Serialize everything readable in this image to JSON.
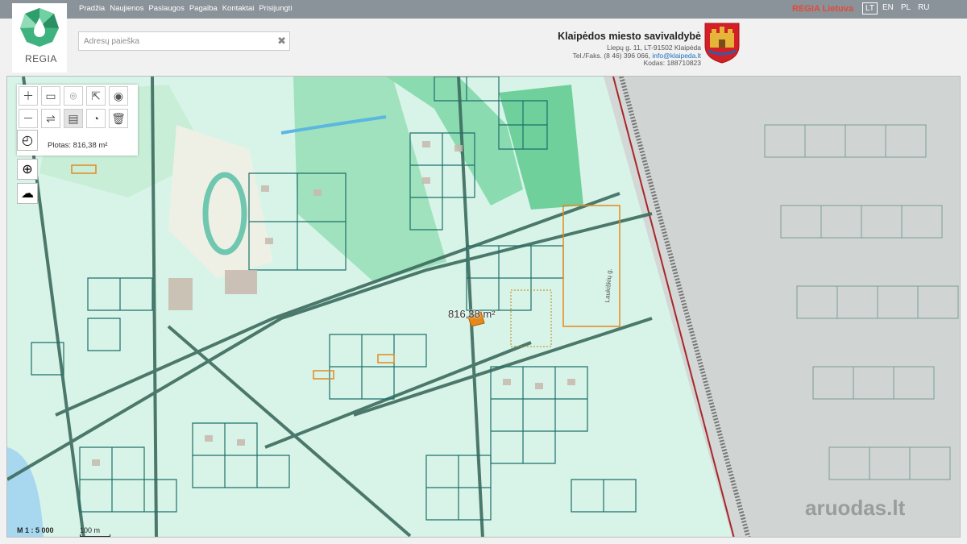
{
  "nav": {
    "items": [
      "Pradžia",
      "Naujienos",
      "Paslaugos",
      "Pagalba",
      "Kontaktai",
      "Prisijungti"
    ]
  },
  "brand": {
    "label": "REGIA Lietuva"
  },
  "languages": [
    "LT",
    "EN",
    "PL",
    "RU"
  ],
  "logo": {
    "text": "REGIA"
  },
  "search": {
    "placeholder": "Adresų paieška",
    "clear_icon": "✖"
  },
  "municipality": {
    "name": "Klaipėdos miesto savivaldybė",
    "address": "Liepų g. 11, LT-91502 Klaipėda",
    "phone_prefix": "Tel./Faks. (8 46) 396 066,",
    "email": "info@klaipeda.lt",
    "code": "Kodas: 188710823"
  },
  "tools": {
    "area_text": "Plotas: 816,38 m²"
  },
  "map": {
    "area_label": "816,38 m²",
    "street_label": "Laukiškių g.",
    "scale_text": "M 1 : 5 000",
    "scale_bar_label": "100 m",
    "watermark": "aruodas.lt"
  },
  "colors": {
    "topbar": "#8a929a",
    "brand": "#e34b37",
    "map_bg": "#d7f3e7",
    "parcel_line": "#1d6f6a",
    "selected_parcel": "#e28a1e"
  }
}
